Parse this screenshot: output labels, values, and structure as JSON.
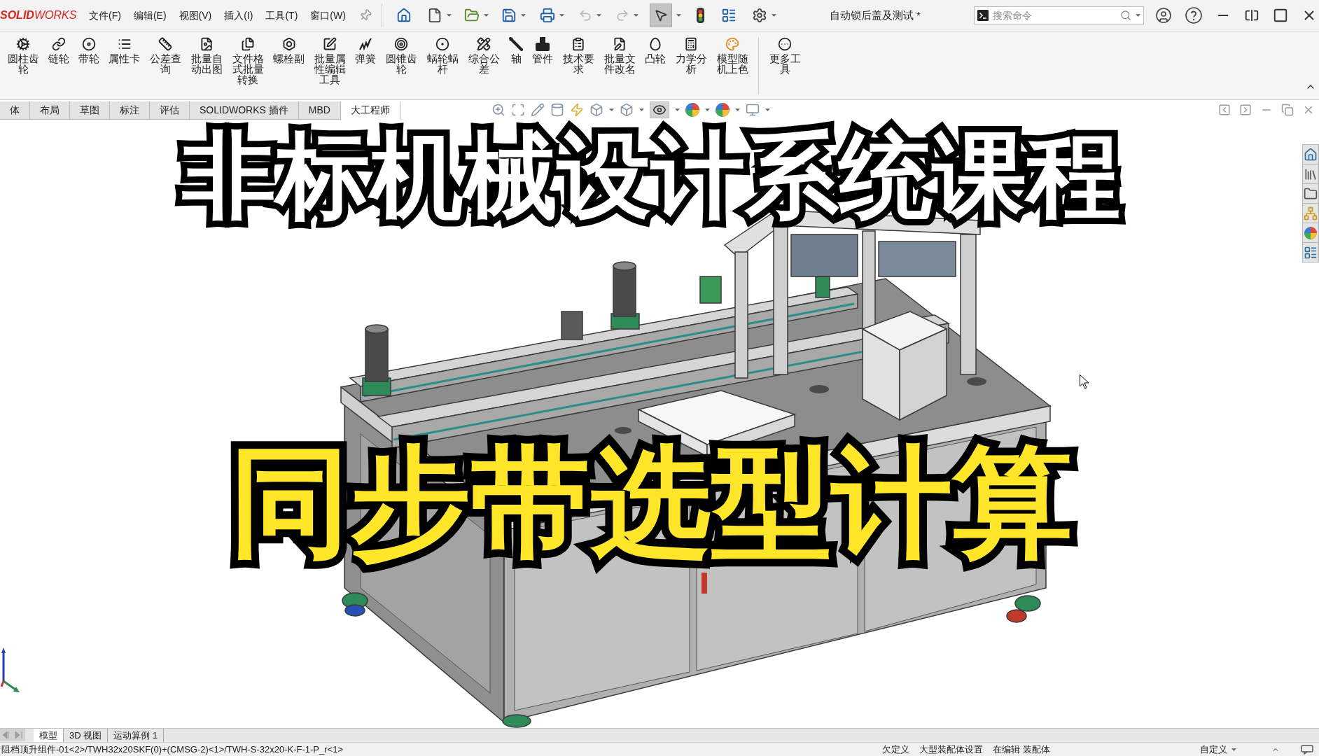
{
  "app_logo": "**SOLID**WORKS",
  "menu": [
    {
      "label": "文件(F)"
    },
    {
      "label": "编辑(E)"
    },
    {
      "label": "视图(V)"
    },
    {
      "label": "插入(I)"
    },
    {
      "label": "工具(T)"
    },
    {
      "label": "窗口(W)"
    }
  ],
  "select_tool": {
    "selected": true
  },
  "document_title": "自动锁后盖及测试 *",
  "search": {
    "placeholder": "搜索命令"
  },
  "commands": [
    {
      "label": "圆柱齿轮"
    },
    {
      "label": "链轮"
    },
    {
      "label": "带轮"
    },
    {
      "label": "属性卡"
    },
    {
      "label": "公差查询"
    },
    {
      "label": "批量自动出图"
    },
    {
      "label": "文件格式批量转换"
    },
    {
      "label": "螺栓副"
    },
    {
      "label": "批量属性编辑工具"
    },
    {
      "label": "弹簧"
    },
    {
      "label": "圆锥齿轮"
    },
    {
      "label": "蜗轮蜗杆"
    },
    {
      "label": "综合公差"
    },
    {
      "label": "轴"
    },
    {
      "label": "管件"
    },
    {
      "label": "技术要求"
    },
    {
      "label": "批量文件改名"
    },
    {
      "label": "凸轮"
    },
    {
      "label": "力学分析"
    },
    {
      "label": "模型随机上色"
    }
  ],
  "more_tools": {
    "label": "更多工具"
  },
  "tabs": [
    {
      "label": "体",
      "selected": false
    },
    {
      "label": "布局",
      "selected": false
    },
    {
      "label": "草图",
      "selected": false
    },
    {
      "label": "标注",
      "selected": false
    },
    {
      "label": "评估",
      "selected": false
    },
    {
      "label": "SOLIDWORKS 插件",
      "selected": false
    },
    {
      "label": "MBD",
      "selected": false
    },
    {
      "label": "大工程师",
      "selected": true
    }
  ],
  "hide_show_tool": {
    "selected": true
  },
  "captions": [
    {
      "text": "非标机械设计系统课程",
      "color": "#ffffff"
    },
    {
      "text": "同步带选型计算",
      "color": "#ffe629"
    }
  ],
  "sheet_tabs": [
    {
      "label": "模型",
      "selected": true
    },
    {
      "label": "3D 视图",
      "selected": false
    },
    {
      "label": "运动算例 1",
      "selected": false
    }
  ],
  "status_bar": {
    "path": "阻档顶升组件-01<2>/TWH32x20SKF(0)+(CMSG-2)<1>/TWH-S-32x20-K-F-1-P_r<1>",
    "items": [
      {
        "label": "欠定义"
      },
      {
        "label": "大型装配体设置"
      },
      {
        "label": "在编辑 装配体"
      },
      {
        "label": "自定义"
      }
    ]
  }
}
